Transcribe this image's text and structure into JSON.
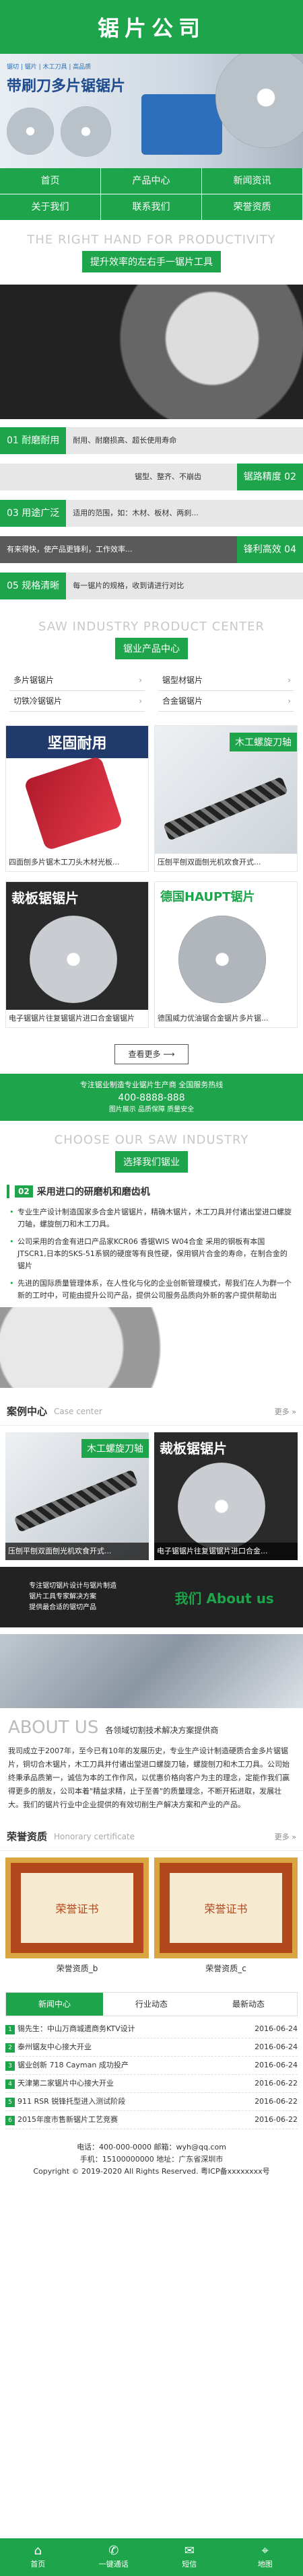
{
  "header": {
    "logo": "锯片公司"
  },
  "banner": {
    "tagline": "锯切 | 锯片 | 木工刀具 | 高品质",
    "title": "带刷刀多片锯锯片"
  },
  "nav": {
    "items": [
      "首页",
      "产品中心",
      "新闻资讯",
      "关于我们",
      "联系我们",
      "荣誉资质"
    ]
  },
  "advantages": {
    "en": "THE RIGHT HAND FOR PRODUCTIVITY",
    "cn": "提升效率的左右手一锯片工具",
    "items": [
      {
        "tag": "01 耐磨耐用",
        "text": "耐用、耐磨损高、超长使用寿命"
      },
      {
        "tag": "锯路精度 02",
        "text": "锯型、整齐、不崩齿"
      },
      {
        "tag": "03 用途广泛",
        "text": "适用的范围，如：木材、板材、两刹..."
      },
      {
        "tag": "锋利高效 04",
        "text": "有来得快，使产品更锋利，工作效率..."
      },
      {
        "tag": "05 规格清晰",
        "text": "每一锯片的规格，收到请进行对比"
      }
    ]
  },
  "products": {
    "en": "SAW INDUSTRY PRODUCT CENTER",
    "cn": "锯业产品中心",
    "categories": [
      "多片锯锯片",
      "锯型材锯片",
      "切铁冷锯锯片",
      "合金锯锯片"
    ],
    "items": [
      {
        "img_text": "坚固耐用",
        "caption": "四面刨多片锯木工刀头木材光板..."
      },
      {
        "img_text": "木工螺旋刀轴",
        "caption": "压刨平刨双面刨光机欢食开式..."
      },
      {
        "img_text": "裁板锯锯片",
        "caption": "电子锯锯片往复锯锯片进口合金锯锯片"
      },
      {
        "img_text": "德国HAUPT锯片",
        "caption": "德国威力优油锯合金锯片多片锯..."
      }
    ],
    "more": "查看更多"
  },
  "hotline": {
    "line1": "专注锯业制造专业锯片生产商 全国服务热线",
    "phone": "400-8888-888",
    "line2": "图片展示 品质保障 质量安全"
  },
  "why": {
    "en": "CHOOSE OUR SAW INDUSTRY",
    "cn": "选择我们锯业",
    "num": "02",
    "title": "采用进口的研磨机和磨齿机",
    "points": [
      "专业生产设计制造国家多合金片锯锯片，精确木锯片，木工刀具并付诸出堂进口螺旋刀轴，螺旋刨刀和木工刀具。",
      "公司采用的合金有进口产品家KCR06 香锯WIS W04合金 采用的钢板有本国JTSCR1,日本的SKS-51系钢的硬度等有良性硬，保用钢片合金的寿命，在制合金的锯片",
      "先进的国际质量管理体系，在人性化与化的企业创新管理模式，帮我们在人为群一个新的工时中，可能由提升公司产品，提供公司服务品质向外新的客户提供帮助出"
    ]
  },
  "cases": {
    "title": "案例中心",
    "sub": "Case center",
    "more": "更多 »",
    "items": [
      {
        "img_text": "木工螺旋刀轴",
        "label": "压刨平刨双面刨光机欢食开式..."
      },
      {
        "img_text": "裁板锯锯片",
        "label": "电子锯锯片往复锯锯片进口合金..."
      }
    ]
  },
  "contact_banner": {
    "l1": "专注锯切锯片设计与锯片制造",
    "l2": "锯片工具专家解决方案",
    "l3": "提供最合适的锯切产品",
    "r": "我们 About us"
  },
  "about": {
    "en": "ABOUT US",
    "cn": "各领域切割技术解决方案提供商",
    "text": "我司成立于2007年，至今已有10年的发展历史，专业生产设计制造硬质合金多片锯锯片，铜切合木锯片，木工刀具并付诸出堂进口螺旋刀轴，螺旋刨刀和木工刀具。公司始终秉承品质第一，诚信为本的工作作风，以优惠价格向客户为主的理念，定能作我们赢得更多的朋友，公司本着\"精益求精，止于至善\"的质量理念，不断开拓进取，发展壮大。我们的锯片行业中企业提供的有效切削生产解决方案和产业的产品。"
  },
  "honors": {
    "title": "荣誉资质",
    "sub": "Honorary certificate",
    "more": "更多 »",
    "items": [
      {
        "img_text": "荣誉证书",
        "caption": "荣誉资质_b"
      },
      {
        "img_text": "荣誉证书",
        "caption": "荣誉资质_c"
      }
    ]
  },
  "news": {
    "tabs": [
      "新闻中心",
      "行业动态",
      "最新动态"
    ],
    "rows": [
      {
        "n": "1",
        "title": "锡先生：中山万商城遗商务KTV设计",
        "date": "2016-06-24"
      },
      {
        "n": "2",
        "title": "泰州锯友中心接大开业",
        "date": "2016-06-24"
      },
      {
        "n": "3",
        "title": "锯业创新 718 Cayman 成功投产",
        "date": "2016-06-24"
      },
      {
        "n": "4",
        "title": "天津第二家锯片中心接大开业",
        "date": "2016-06-22"
      },
      {
        "n": "5",
        "title": "911 RSR 锐锋托型进入测试阶段",
        "date": "2016-06-22"
      },
      {
        "n": "6",
        "title": "2015年度市售新锯片工艺竞赛",
        "date": "2016-06-22"
      }
    ]
  },
  "footer": {
    "line1": "电话：400-000-0000  邮箱：wyh@qq.com",
    "line2": "手机：15100000000  地址：广东省深圳市",
    "line3": "Copyright © 2019-2020 All Rights Reserved. 粤ICP备xxxxxxxx号"
  },
  "bottom_bar": [
    {
      "icon": "⌂",
      "label": "首页"
    },
    {
      "icon": "✆",
      "label": "一键通话"
    },
    {
      "icon": "✉",
      "label": "短信"
    },
    {
      "icon": "⌖",
      "label": "地图"
    }
  ]
}
